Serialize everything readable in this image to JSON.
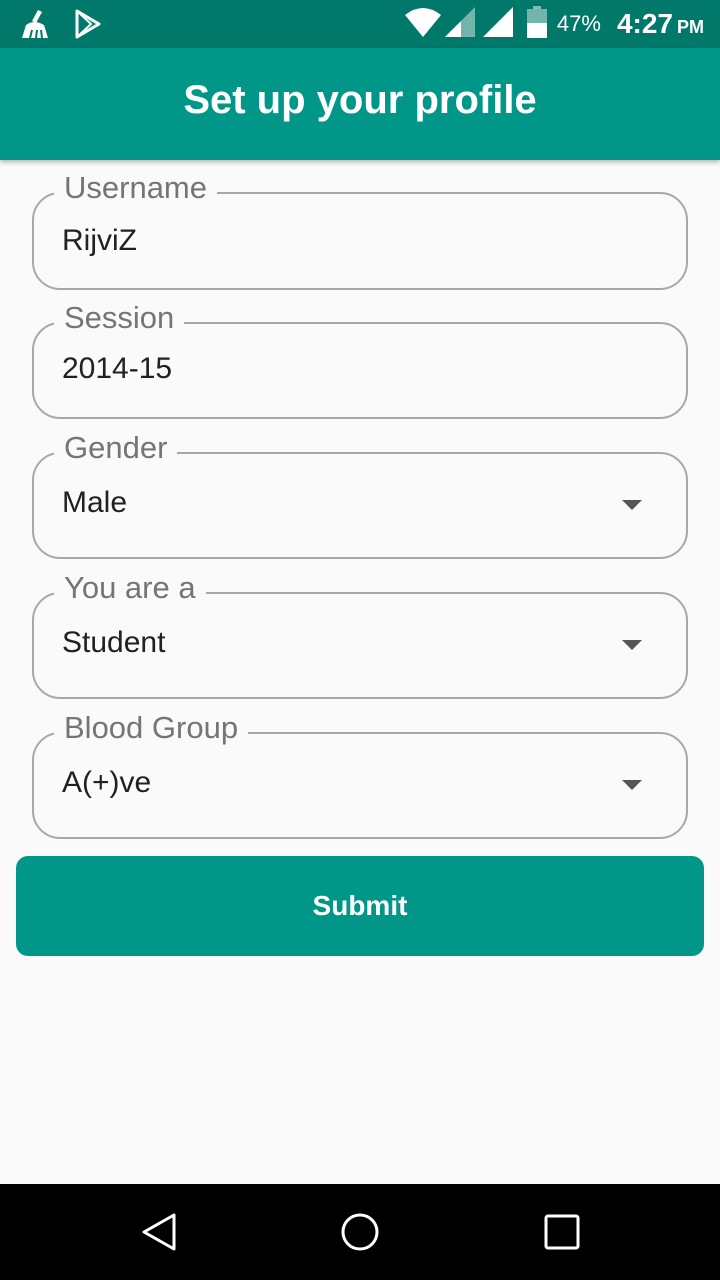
{
  "status_bar": {
    "battery_percent": "47%",
    "time": "4:27",
    "ampm": "PM",
    "icons": [
      "cleaner-icon",
      "play-store-icon",
      "wifi-icon",
      "signal-icon",
      "signal-icon",
      "battery-icon"
    ]
  },
  "app_bar": {
    "title": "Set up your profile"
  },
  "form": {
    "username": {
      "label": "Username",
      "value": "RijviZ"
    },
    "session": {
      "label": "Session",
      "value": "2014-15"
    },
    "gender": {
      "label": "Gender",
      "value": "Male"
    },
    "role": {
      "label": "You are a",
      "value": "Student"
    },
    "blood_group": {
      "label": "Blood Group",
      "value": "A(+)ve"
    },
    "submit_label": "Submit"
  },
  "nav_bar": {
    "icons": [
      "back-icon",
      "home-icon",
      "recents-icon"
    ]
  },
  "colors": {
    "primary": "#009688",
    "primary_dark": "#00796b",
    "background": "#fafafa"
  }
}
